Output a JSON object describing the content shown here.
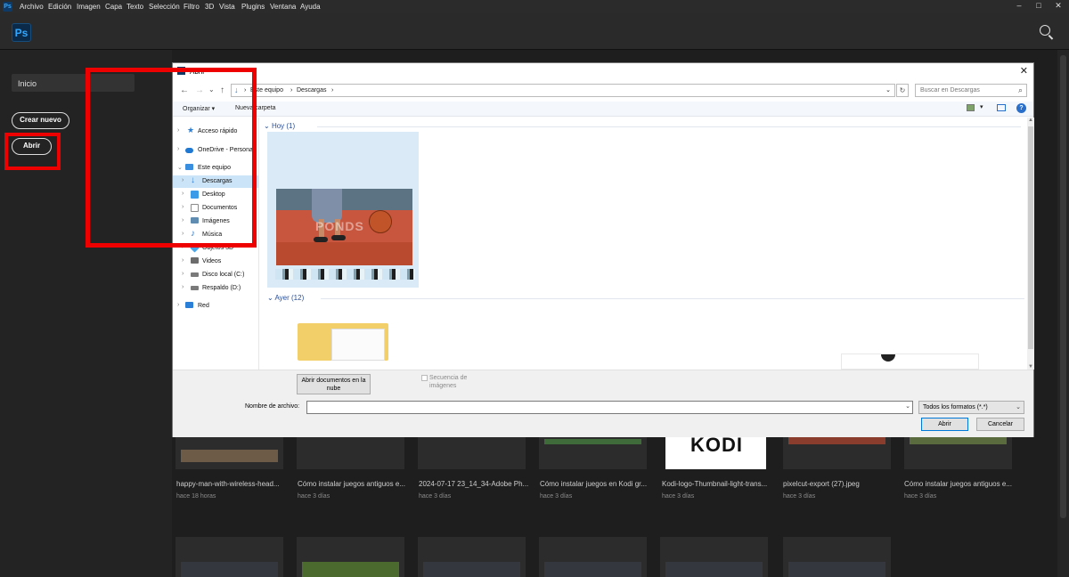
{
  "menubar": {
    "app_badge": "Ps",
    "items": [
      "Archivo",
      "Edición",
      "Imagen",
      "Capa",
      "Texto",
      "Selección",
      "Filtro",
      "3D",
      "Vista",
      "Plugins",
      "Ventana",
      "Ayuda"
    ],
    "window_controls": {
      "minimize": "–",
      "maximize": "□",
      "close": "✕"
    }
  },
  "topbar": {
    "logo": "Ps"
  },
  "leftpanel": {
    "home": "Inicio",
    "create_new": "Crear nuevo",
    "open": "Abrir"
  },
  "recent_files": [
    {
      "title": "happy-man-with-wireless-head...",
      "date": "hace 18 horas"
    },
    {
      "title": "Cómo instalar juegos antiguos e...",
      "date": "hace 3 días"
    },
    {
      "title": "2024-07-17 23_14_34-Adobe Ph...",
      "date": "hace 3 días"
    },
    {
      "title": "Cómo instalar juegos en Kodi gr...",
      "date": "hace 3 días"
    },
    {
      "title": "Kodi-logo-Thumbnail-light-trans...",
      "date": "hace 3 días",
      "thumb_text": "KODI"
    },
    {
      "title": "pixelcut-export (27).jpeg",
      "date": "hace 3 días"
    },
    {
      "title": "Cómo instalar juegos antiguos e...",
      "date": "hace 3 días"
    }
  ],
  "dialog": {
    "title": "Abrir",
    "close": "✕",
    "nav": {
      "back": "←",
      "forward": "→",
      "dropdown": "⌄",
      "up": "↑"
    },
    "address": {
      "root": "Este equipo",
      "sep1": "›",
      "folder": "Descargas",
      "sep2": "›",
      "dropdown": "⌄",
      "refresh": "↻"
    },
    "search_placeholder": "Buscar en Descargas",
    "toolbar": {
      "organize": "Organizar ▾",
      "new_folder": "Nueva carpeta",
      "help": "?"
    },
    "sidebar": [
      {
        "label": "Acceso rápido",
        "icon": "star-icon",
        "color": "#2b7fd6"
      },
      {
        "label": "OneDrive - Personal",
        "icon": "cloud-icon",
        "color": "#1f78d1"
      },
      {
        "label": "Este equipo",
        "icon": "computer-icon",
        "color": "#3a8ee0"
      },
      {
        "label": "Descargas",
        "icon": "download-icon",
        "color": "#2b7fd6",
        "selected": true
      },
      {
        "label": "Desktop",
        "icon": "desktop-icon",
        "color": "#3a9be8"
      },
      {
        "label": "Documentos",
        "icon": "document-icon",
        "color": "#8a8a8a"
      },
      {
        "label": "Imágenes",
        "icon": "pictures-icon",
        "color": "#5f8cb0"
      },
      {
        "label": "Música",
        "icon": "music-icon",
        "color": "#2d7dd2"
      },
      {
        "label": "Objetos 3D",
        "icon": "cube-icon",
        "color": "#4aa7e8"
      },
      {
        "label": "Videos",
        "icon": "video-icon",
        "color": "#6c6c6c"
      },
      {
        "label": "Disco local (C:)",
        "icon": "drive-icon",
        "color": "#7a7a7a"
      },
      {
        "label": "Respaldo (D:)",
        "icon": "drive-icon",
        "color": "#7a7a7a"
      },
      {
        "label": "Red",
        "icon": "network-icon",
        "color": "#2b7fd6"
      }
    ],
    "groups": {
      "today": "Hoy (1)",
      "yesterday": "Ayer (12)"
    },
    "thumbnail_watermark": "PONDS",
    "open_cloud_docs": "Abrir documentos en la nube",
    "image_sequence": "Secuencia de imágenes",
    "filename_label": "Nombre de archivo:",
    "filename_value": "",
    "format": "Todos los formatos (*.*)",
    "open_button": "Abrir",
    "cancel_button": "Cancelar"
  },
  "colors": {
    "highlight": "#ee0000",
    "ps_blue": "#31a8ff",
    "app_bg": "#1e1e1e"
  }
}
